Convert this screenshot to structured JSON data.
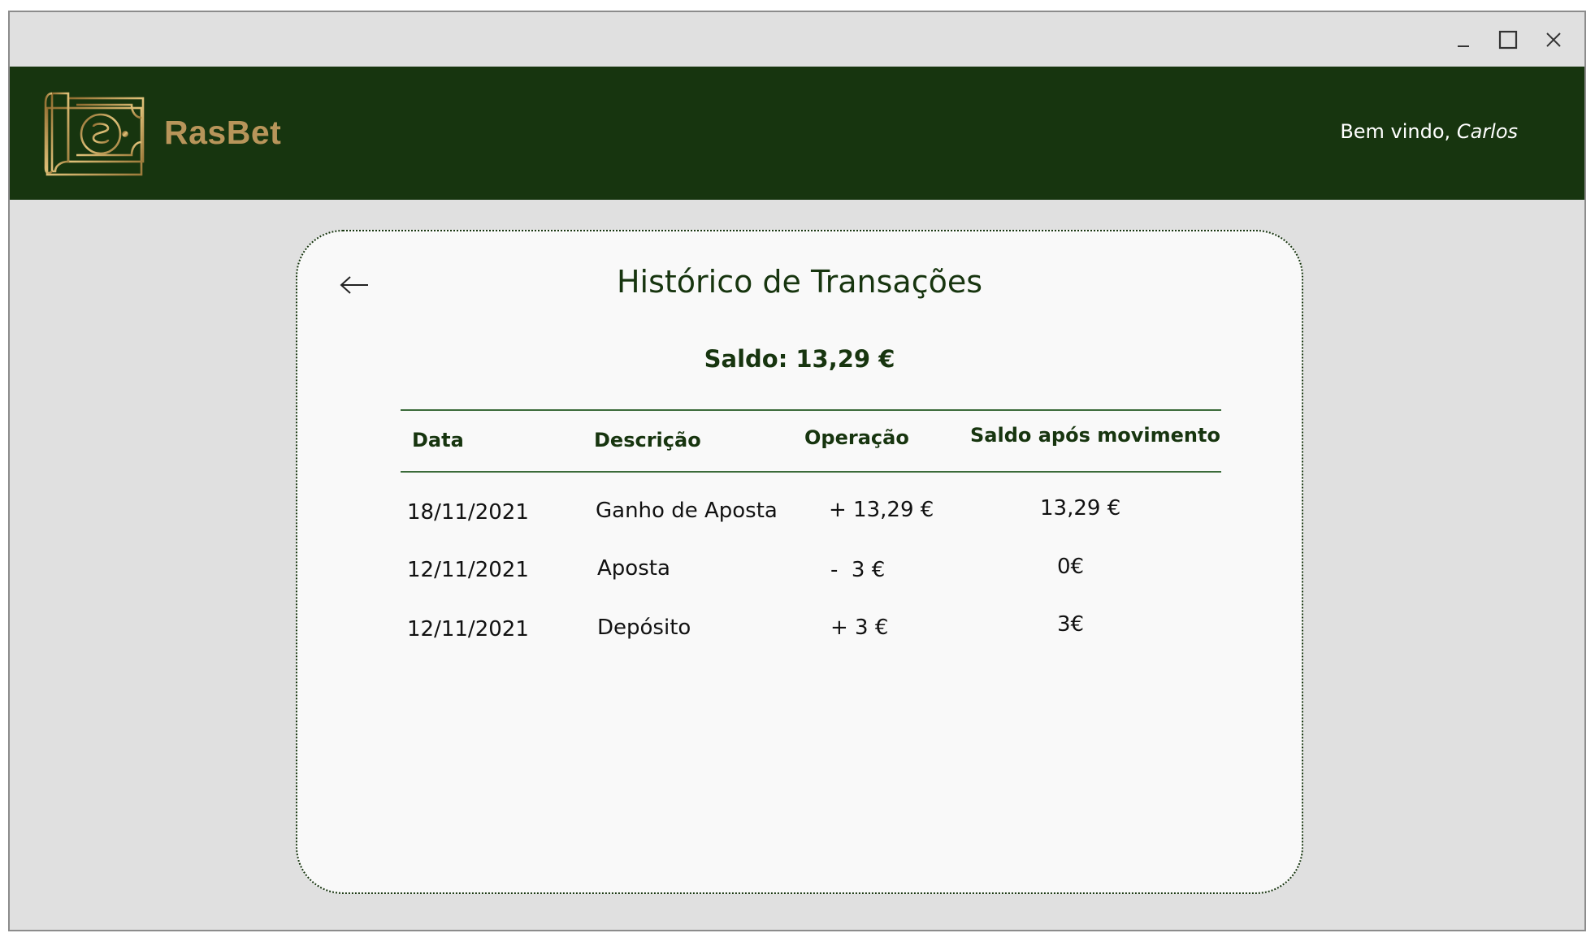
{
  "app": {
    "name": "RasBet",
    "brand_color": "#17350f",
    "accent_color": "#b8955a"
  },
  "window_controls": {
    "minimize_icon": "minimize-icon",
    "maximize_icon": "maximize-icon",
    "close_icon": "close-icon"
  },
  "header": {
    "logo_icon": "money-bill-icon",
    "logo_text": "RasBet",
    "welcome_prefix": "Bem vindo, ",
    "user_name": "Carlos"
  },
  "page": {
    "back_icon": "back-arrow-icon",
    "title": "Histórico de Transações",
    "balance": "Saldo: 13,29 €"
  },
  "table": {
    "columns": [
      "Data",
      "Descrição",
      "Operação",
      "Saldo após movimento"
    ],
    "rows": [
      [
        "18/11/2021",
        "Ganho de Aposta",
        "+ 13,29 €",
        "13,29 €"
      ],
      [
        "12/11/2021",
        "Aposta",
        "-  3 €",
        "0€"
      ],
      [
        "12/11/2021",
        "Depósito",
        "+ 3 €",
        "3€"
      ]
    ]
  }
}
